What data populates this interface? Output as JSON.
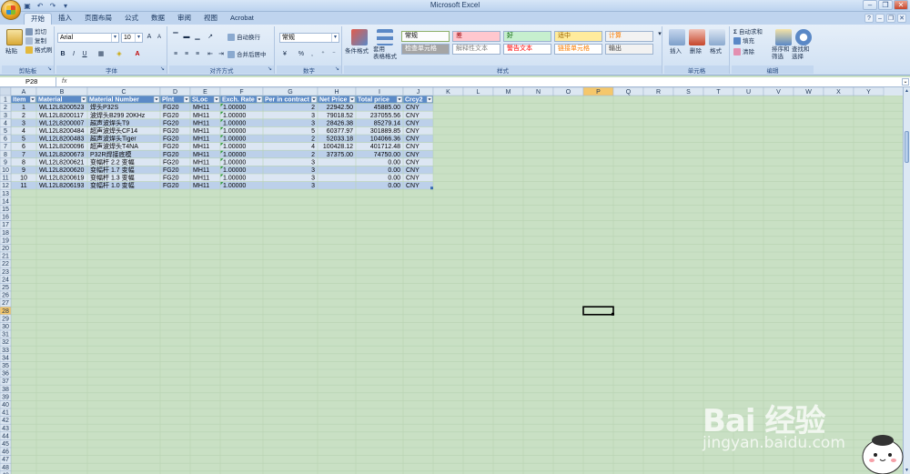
{
  "window": {
    "title": "Microsoft Excel"
  },
  "qat": [
    "save-icon",
    "undo-icon",
    "redo-icon",
    "customize-icon"
  ],
  "tabs": [
    {
      "label": "开始",
      "active": true
    },
    {
      "label": "插入"
    },
    {
      "label": "页面布局"
    },
    {
      "label": "公式"
    },
    {
      "label": "数据"
    },
    {
      "label": "审阅"
    },
    {
      "label": "视图"
    },
    {
      "label": "Acrobat"
    }
  ],
  "ribbon": {
    "clipboard": {
      "label": "剪贴板",
      "paste": "粘贴",
      "cut": "剪切",
      "copy": "复制",
      "format_painter": "格式刷"
    },
    "font": {
      "label": "字体",
      "font_name": "Arial",
      "font_size": "10"
    },
    "alignment": {
      "label": "对齐方式",
      "wrap": "自动换行",
      "merge": "合并后居中"
    },
    "number": {
      "label": "数字",
      "format": "常规"
    },
    "styles": {
      "label": "样式",
      "conditional": "条件格式",
      "table": "套用\n表格格式",
      "cells": [
        {
          "text": "常规",
          "bg": "#fdfdfd",
          "fg": "#000000",
          "border": "#8fb06a"
        },
        {
          "text": "差",
          "bg": "#ffc7ce",
          "fg": "#9c0006"
        },
        {
          "text": "好",
          "bg": "#c6efce",
          "fg": "#006100"
        },
        {
          "text": "适中",
          "bg": "#ffeb9c",
          "fg": "#9c6500"
        },
        {
          "text": "计算",
          "bg": "#f2f2f2",
          "fg": "#fa7d00"
        },
        {
          "text": "检查单元格",
          "bg": "#a5a5a5",
          "fg": "#ffffff"
        },
        {
          "text": "解释性文本",
          "bg": "#ffffff",
          "fg": "#7f7f7f"
        },
        {
          "text": "警告文本",
          "bg": "#ffffff",
          "fg": "#ff0000"
        },
        {
          "text": "链接单元格",
          "bg": "#ffffff",
          "fg": "#fa7d00"
        },
        {
          "text": "输出",
          "bg": "#f2f2f2",
          "fg": "#3f3f3f"
        }
      ]
    },
    "cells_group": {
      "label": "单元格",
      "insert": "插入",
      "delete": "删除",
      "format": "格式"
    },
    "editing": {
      "label": "编辑",
      "autosum": "自动求和",
      "fill": "填充",
      "clear": "清除",
      "sort": "排序和\n筛选",
      "find": "查找和\n选择"
    }
  },
  "formula_bar": {
    "name_box": "P28",
    "fx": "fx",
    "value": ""
  },
  "columns": [
    "A",
    "B",
    "C",
    "D",
    "E",
    "F",
    "G",
    "H",
    "I",
    "J",
    "K",
    "L",
    "M",
    "N",
    "O",
    "P",
    "Q",
    "R",
    "S",
    "T",
    "U",
    "V",
    "W",
    "X",
    "Y"
  ],
  "column_widths": [
    28,
    56,
    80,
    33,
    33,
    47,
    60,
    42,
    52,
    33,
    33,
    33,
    33,
    33,
    33,
    33,
    33,
    33,
    33,
    33,
    33,
    33,
    33,
    33,
    33
  ],
  "row_count": 49,
  "selected_cell": {
    "col": "P",
    "row": 28
  },
  "table": {
    "headers": [
      "Item",
      "Material",
      "Material Number",
      "Plnt",
      "SLoc",
      "Exch. Rate",
      "Per in contract",
      "Net Price",
      "Total price",
      "Crcy2"
    ],
    "rows": [
      [
        "1",
        "WL12L8200523",
        "焊头P32S",
        "FG20",
        "MH11",
        "1.00000",
        "2",
        "22942.50",
        "45885.00",
        "CNY"
      ],
      [
        "2",
        "WL12L8200117",
        "波焊头B299 20KHz",
        "FG20",
        "MH11",
        "1.00000",
        "3",
        "79018.52",
        "237055.56",
        "CNY"
      ],
      [
        "3",
        "WL12L8200007",
        "超声波焊头T9",
        "FG20",
        "MH11",
        "1.00000",
        "3",
        "28426.38",
        "85279.14",
        "CNY"
      ],
      [
        "4",
        "WL12L8200484",
        "超声波焊头CF14",
        "FG20",
        "MH11",
        "1.00000",
        "5",
        "60377.97",
        "301889.85",
        "CNY"
      ],
      [
        "5",
        "WL12L8200483",
        "超声波焊头Tiger",
        "FG20",
        "MH11",
        "1.00000",
        "2",
        "52033.18",
        "104066.36",
        "CNY"
      ],
      [
        "6",
        "WL12L8200096",
        "超声波焊头T4NA",
        "FG20",
        "MH11",
        "1.00000",
        "4",
        "100428.12",
        "401712.48",
        "CNY"
      ],
      [
        "7",
        "WL12L8200673",
        "P32R焊接底模",
        "FG20",
        "MH11",
        "1.00000",
        "2",
        "37375.00",
        "74750.00",
        "CNY"
      ],
      [
        "8",
        "WL12L8200621",
        "变幅杆 2.2 变幅",
        "FG20",
        "MH11",
        "1.00000",
        "3",
        "",
        "0.00",
        "CNY"
      ],
      [
        "9",
        "WL12L8200620",
        "变幅杆 1.7 变幅",
        "FG20",
        "MH11",
        "1.00000",
        "3",
        "",
        "0.00",
        "CNY"
      ],
      [
        "10",
        "WL12L8200619",
        "变幅杆 1.3 变幅",
        "FG20",
        "MH11",
        "1.00000",
        "3",
        "",
        "0.00",
        "CNY"
      ],
      [
        "11",
        "WL12L8206193",
        "变幅杆 1.0 变幅",
        "FG20",
        "MH11",
        "1.00000",
        "3",
        "",
        "0.00",
        "CNY"
      ]
    ],
    "align": [
      "center",
      "left",
      "left",
      "left",
      "left",
      "left",
      "right",
      "right",
      "right",
      "left"
    ]
  },
  "colors": {
    "sheet_bg": "#c9e0c4",
    "grid_line": "#b8d2b2",
    "header_bg": "#dce7f2",
    "header_active": "#f5c76b",
    "table_head": "#5b8ac7",
    "band_a": "#dce6f3",
    "band_b": "#bcd0ea"
  },
  "watermark": {
    "brand": "Bai 经验",
    "url": "jingyan.baidu.com"
  }
}
